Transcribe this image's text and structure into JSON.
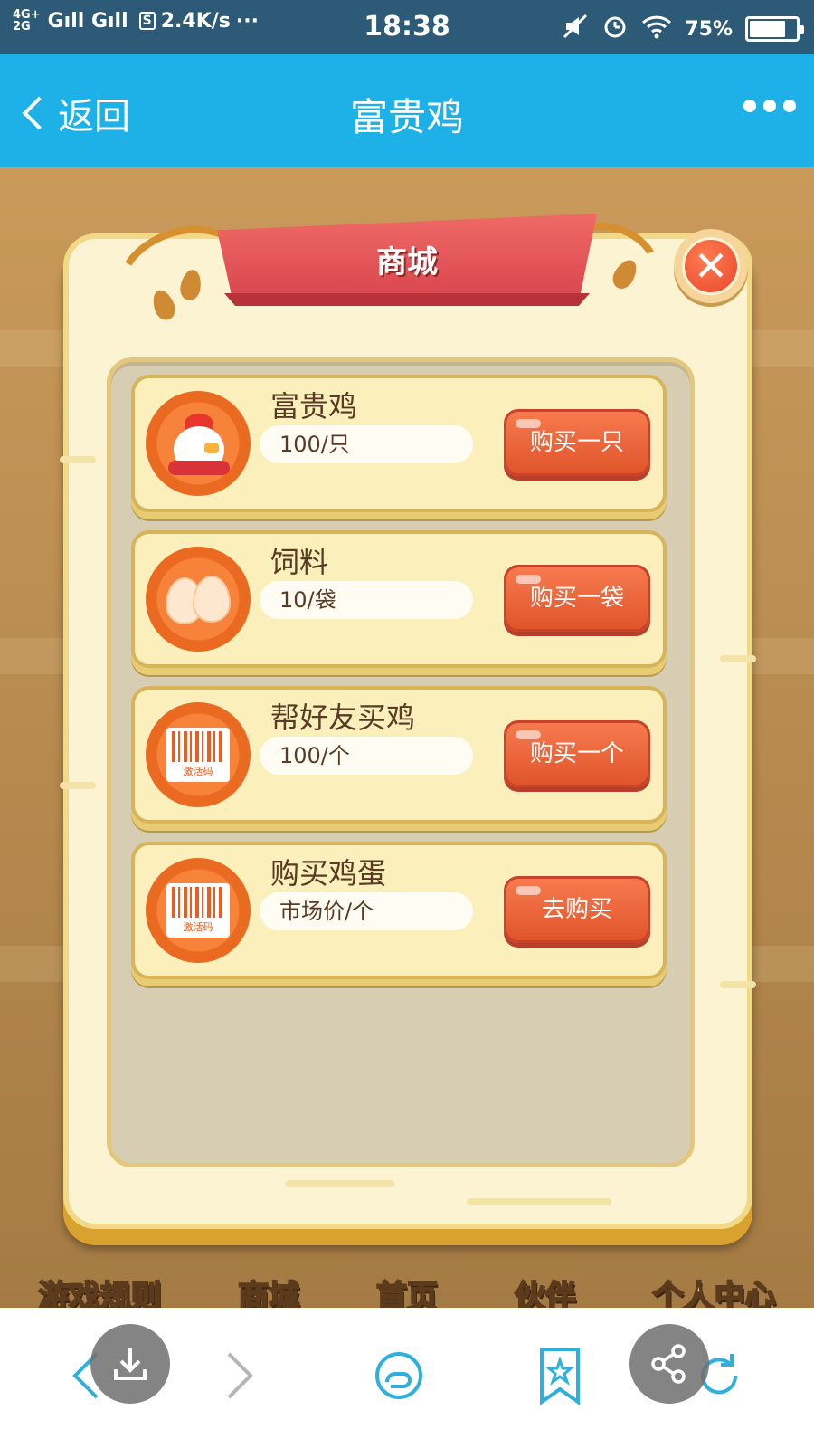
{
  "status_bar": {
    "network_top": "4G+",
    "network_bottom": "2G",
    "signal_text": "Gıll Gıll",
    "speed": "2.4K/s",
    "sim_box": "S",
    "dots": "···",
    "time": "18:38",
    "battery": "75%"
  },
  "nav": {
    "back_label": "返回",
    "title": "富贵鸡",
    "more_icon": "more-dots-icon"
  },
  "game_menu": [
    "游戏规则",
    "商城",
    "首页",
    "伙伴",
    "个人中心"
  ],
  "dialog": {
    "title": "商城",
    "close_icon": "close-x-icon"
  },
  "shop_items": [
    {
      "name": "富贵鸡",
      "price": "100/只",
      "button": "购买一只",
      "icon": "chicken-icon"
    },
    {
      "name": "饲料",
      "price": "10/袋",
      "button": "购买一袋",
      "icon": "eggs-icon"
    },
    {
      "name": "帮好友买鸡",
      "price": "100/个",
      "button": "购买一个",
      "icon": "barcode-icon",
      "icon_text": "激活码"
    },
    {
      "name": "购买鸡蛋",
      "price": "市场价/个",
      "button": "去购买",
      "icon": "barcode-icon",
      "icon_text": "激活码"
    }
  ],
  "colors": {
    "nav_bg": "#1eb1e8",
    "status_bg": "#2d5a76",
    "banner_red": "#e4545a",
    "button_orange": "#ec6534",
    "card_bg": "#fbf0bc",
    "toolbar_icon": "#2fb0dc"
  },
  "toolbar": {
    "icons": [
      "back-arrow-icon",
      "download-icon",
      "forward-arrow-icon",
      "home-cloud-icon",
      "bookmark-star-icon",
      "refresh-icon",
      "share-icon"
    ]
  }
}
